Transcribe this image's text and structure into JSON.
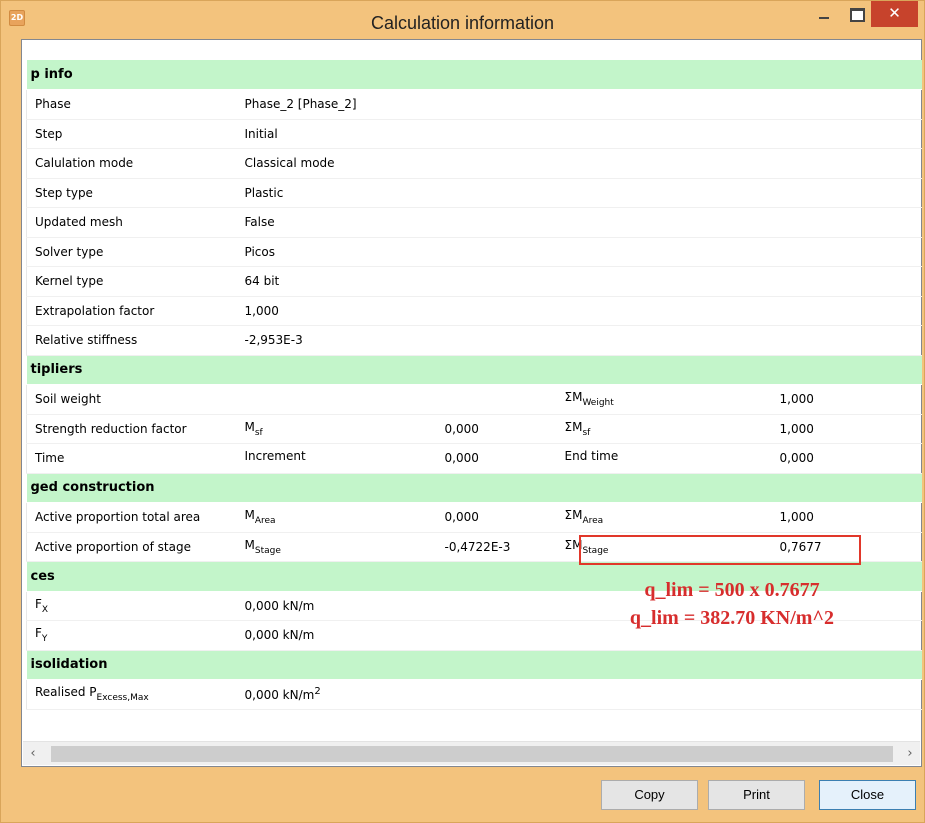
{
  "window": {
    "title": "Calculation information",
    "app_icon_text": "2D",
    "close_glyph": "✕"
  },
  "sections": [
    {
      "header": "p info",
      "rows": [
        {
          "label": "Phase",
          "value": "Phase_2 [Phase_2]"
        },
        {
          "label": "Step",
          "value": "Initial"
        },
        {
          "label": "Calulation mode",
          "value": "Classical mode"
        },
        {
          "label": "Step type",
          "value": "Plastic"
        },
        {
          "label": "Updated mesh",
          "value": "False"
        },
        {
          "label": "Solver type",
          "value": "Picos"
        },
        {
          "label": "Kernel type",
          "value": "64 bit"
        },
        {
          "label": "Extrapolation factor",
          "value": "1,000"
        },
        {
          "label": "Relative stiffness",
          "value": "-2,953E-3"
        }
      ]
    },
    {
      "header": "tipliers",
      "rows": [
        {
          "label": "Soil weight",
          "sym_base": "",
          "sym_sub": "",
          "value": "",
          "total_base": "ΣM",
          "total_sub": "Weight",
          "total_value": "1,000"
        },
        {
          "label": "Strength reduction factor",
          "sym_base": "M",
          "sym_sub": "sf",
          "value": "0,000",
          "total_base": "ΣM",
          "total_sub": "sf",
          "total_value": "1,000"
        },
        {
          "label": "Time",
          "sym_base": "Increment",
          "sym_sub": "",
          "value": "0,000",
          "total_base": "End time",
          "total_sub": "",
          "total_value": "0,000"
        }
      ]
    },
    {
      "header": "ged construction",
      "rows": [
        {
          "label": "Active proportion total area",
          "sym_base": "M",
          "sym_sub": "Area",
          "value": "0,000",
          "total_base": "ΣM",
          "total_sub": "Area",
          "total_value": "1,000"
        },
        {
          "label": "Active proportion of stage",
          "sym_base": "M",
          "sym_sub": "Stage",
          "value": "-0,4722E-3",
          "total_base": "ΣM",
          "total_sub": "Stage",
          "total_value": "0,7677"
        }
      ]
    },
    {
      "header": "ces",
      "rows": [
        {
          "label_base": "F",
          "label_sub": "X",
          "value": "0,000 kN/m"
        },
        {
          "label_base": "F",
          "label_sub": "Y",
          "value": "0,000 kN/m"
        }
      ]
    },
    {
      "header": "isolidation",
      "rows": [
        {
          "label_base": "Realised P",
          "label_sub": "Excess,Max",
          "value": "0,000 kN/m",
          "value_sup": "2"
        }
      ]
    }
  ],
  "annotation": {
    "line1": "q_lim = 500 x 0.7677",
    "line2": "q_lim = 382.70 KN/m^2",
    "color": "#d72d2d"
  },
  "scrollbar": {
    "left_arrow": "‹",
    "right_arrow": "›"
  },
  "buttons": {
    "copy": "Copy",
    "print": "Print",
    "close": "Close"
  },
  "colors": {
    "titlebar": "#f3c37d",
    "section_header": "#c3f5ca",
    "close_button": "#c7432c",
    "highlight_box": "#e1372a"
  }
}
